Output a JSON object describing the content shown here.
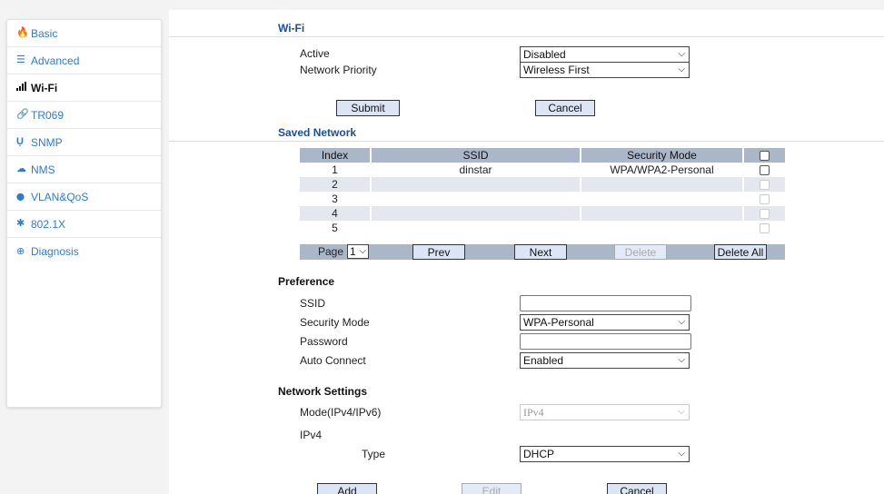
{
  "sidebar": {
    "items": [
      {
        "label": "Basic",
        "icon": "fire-icon",
        "glyph": "🔥"
      },
      {
        "label": "Advanced",
        "icon": "list-icon",
        "glyph": "☰"
      },
      {
        "label": "Wi-Fi",
        "icon": "signal-icon",
        "glyph": "📶"
      },
      {
        "label": "TR069",
        "icon": "link-icon",
        "glyph": "🔗"
      },
      {
        "label": "SNMP",
        "icon": "magnet-icon",
        "glyph": "Ụ"
      },
      {
        "label": "NMS",
        "icon": "cloud-icon",
        "glyph": "☁"
      },
      {
        "label": "VLAN&QoS",
        "icon": "map-marker-icon",
        "glyph": "⬤"
      },
      {
        "label": "802.1X",
        "icon": "asterisk-icon",
        "glyph": "✱"
      },
      {
        "label": "Diagnosis",
        "icon": "search-plus-icon",
        "glyph": "⊕"
      }
    ]
  },
  "wifi": {
    "title": "Wi-Fi",
    "active_label": "Active",
    "active_value": "Disabled",
    "priority_label": "Network Priority",
    "priority_value": "Wireless First",
    "submit": "Submit",
    "cancel": "Cancel"
  },
  "saved": {
    "title": "Saved Network",
    "headers": [
      "Index",
      "SSID",
      "Security Mode"
    ],
    "rows": [
      {
        "index": "1",
        "ssid": "dinstar",
        "mode": "WPA/WPA2-Personal"
      },
      {
        "index": "2",
        "ssid": "",
        "mode": ""
      },
      {
        "index": "3",
        "ssid": "",
        "mode": ""
      },
      {
        "index": "4",
        "ssid": "",
        "mode": ""
      },
      {
        "index": "5",
        "ssid": "",
        "mode": ""
      }
    ],
    "page_label": "Page",
    "page_value": "1",
    "prev": "Prev",
    "next": "Next",
    "delete": "Delete",
    "delete_all": "Delete All"
  },
  "preference": {
    "title": "Preference",
    "ssid_label": "SSID",
    "ssid_value": "",
    "security_label": "Security Mode",
    "security_value": "WPA-Personal",
    "password_label": "Password",
    "password_value": "",
    "auto_label": "Auto Connect",
    "auto_value": "Enabled"
  },
  "network": {
    "title": "Network Settings",
    "mode_label": "Mode(IPv4/IPv6)",
    "mode_value": "IPv4",
    "ipv4_label": "IPv4",
    "type_label": "Type",
    "type_value": "DHCP",
    "add": "Add",
    "edit": "Edit",
    "cancel": "Cancel"
  }
}
